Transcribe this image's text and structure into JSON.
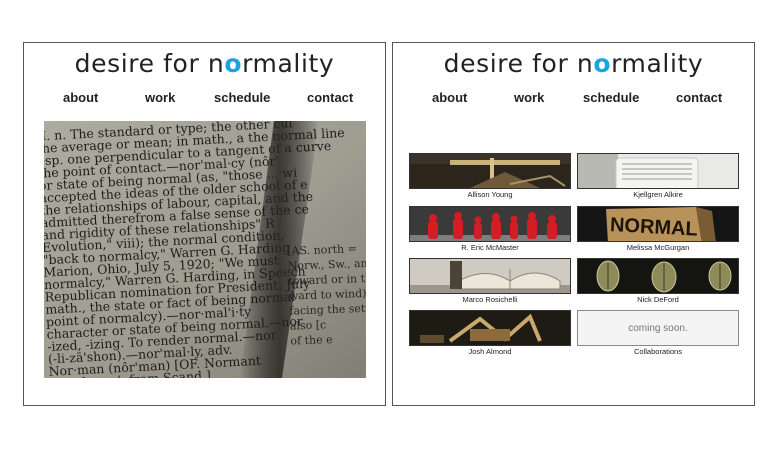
{
  "site": {
    "logo_prefix": "desire for n",
    "logo_o": "o",
    "logo_suffix": "rmality",
    "accent_color": "#1aa3e0"
  },
  "nav": [
    {
      "label": "about"
    },
    {
      "label": "work"
    },
    {
      "label": "schedule"
    },
    {
      "label": "contact"
    }
  ],
  "left_panel": {
    "hero_image": "dictionary-page-normal",
    "dictionary_lines": [
      "II. n. The standard or type; the other cul",
      "the average or mean; in math., a the normal line",
      "esp. one perpendicular to a tangent of a curve",
      "the point of contact.—nor'mal·cy (nôr'",
      "or state of being normal (as, \"those ... wi",
      "accepted the ideas of the older school of e",
      "the relationships of labour, capital, and the",
      "admitted therefrom a false sense of the ce",
      "and rigidity of these relationships\" R",
      "Evolution,\" viii); the normal condition,",
      "\"back to normalcy,\" Warren G. Harding",
      "Marion, Ohio, July 5, 1920; \"We must",
      "normalcy,\" Warren G. Harding, in Speech",
      "Republican nomination for President, July",
      "math., the state or fact of being normal",
      "point of normalcy).—nor·mal'i·ty",
      "character or state of being normal.—nor",
      "-ized, -izing. To render normal.—nor",
      "(-li-zā'shon).—nor'mal·ly, adv.",
      "Nor·man (nôr'man) [OF. Normant",
      "'Northman'; from Scand.]"
    ],
    "dictionary_right_lines": [
      "[AS. north =",
      "Norw., Sw., and",
      "toward or in the",
      "ward to wind).—n",
      "facing the setting",
      "also [c",
      "of the e"
    ]
  },
  "right_panel": {
    "gallery": [
      {
        "caption": "Allison Young",
        "image": "sculpture-sticks-dark"
      },
      {
        "caption": "Kjellgren Alkire",
        "image": "white-appliance-grille"
      },
      {
        "caption": "R. Eric McMaster",
        "image": "red-figurines-row"
      },
      {
        "caption": "Melissa McGurgan",
        "image": "normal-sign-block"
      },
      {
        "caption": "Marco Rosichelli",
        "image": "open-book-sculpture"
      },
      {
        "caption": "Nick DeFord",
        "image": "leaf-objects-dark"
      },
      {
        "caption": "Josh Almond",
        "image": "wood-construction-dark"
      },
      {
        "caption": "Collaborations",
        "image": "",
        "placeholder": "coming soon."
      }
    ]
  }
}
